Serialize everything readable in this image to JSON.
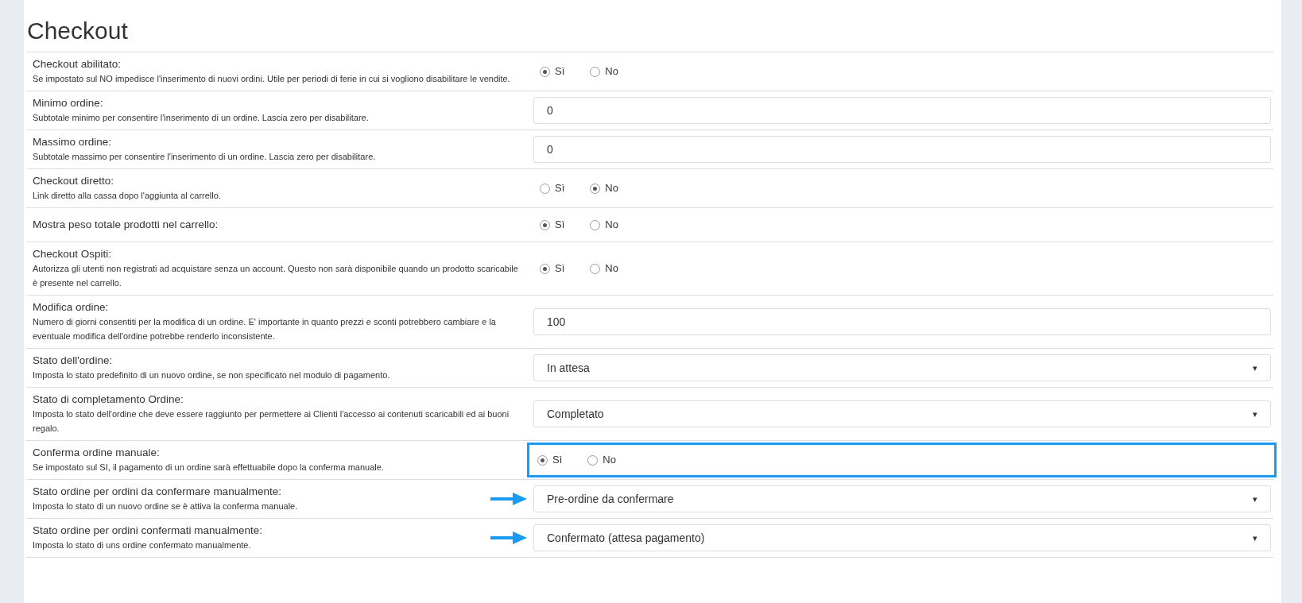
{
  "title": "Checkout",
  "rows": [
    {
      "kind": "radio",
      "label": "Checkout abilitato:",
      "description": "Se impostato sul NO impedisce l'inserimento di nuovi ordini. Utile per periodi di ferie in cui si vogliono disabilitare le vendite.",
      "options": [
        {
          "label": "Sì",
          "selected": true
        },
        {
          "label": "No",
          "selected": false
        }
      ],
      "highlighted": false,
      "arrow": false
    },
    {
      "kind": "text",
      "label": "Minimo ordine:",
      "description": "Subtotale minimo per consentire l'inserimento di un ordine. Lascia zero per disabilitare.",
      "value": "0",
      "highlighted": false,
      "arrow": false
    },
    {
      "kind": "text",
      "label": "Massimo ordine:",
      "description": "Subtotale massimo per consentire l'inserimento di un ordine. Lascia zero per disabilitare.",
      "value": "0",
      "highlighted": false,
      "arrow": false
    },
    {
      "kind": "radio",
      "label": "Checkout diretto:",
      "description": "Link diretto alla cassa dopo l'aggiunta al carrello.",
      "options": [
        {
          "label": "Sì",
          "selected": false
        },
        {
          "label": "No",
          "selected": true
        }
      ],
      "highlighted": false,
      "arrow": false
    },
    {
      "kind": "radio",
      "label": "Mostra peso totale prodotti nel carrello:",
      "options": [
        {
          "label": "Sì",
          "selected": true
        },
        {
          "label": "No",
          "selected": false
        }
      ],
      "highlighted": false,
      "arrow": false
    },
    {
      "kind": "radio",
      "label": "Checkout Ospiti:",
      "description": "Autorizza gli utenti non registrati ad acquistare senza un account. Questo non sarà disponibile quando un prodotto scaricabile è presente nel carrello.",
      "options": [
        {
          "label": "Sì",
          "selected": true
        },
        {
          "label": "No",
          "selected": false
        }
      ],
      "highlighted": false,
      "arrow": false
    },
    {
      "kind": "text",
      "label": "Modifica ordine:",
      "description": "Numero di giorni consentiti per la modifica di un ordine. E' importante in quanto prezzi e sconti potrebbero cambiare e la eventuale modifica dell'ordine potrebbe renderlo inconsistente.",
      "value": "100",
      "highlighted": false,
      "arrow": false
    },
    {
      "kind": "select",
      "label": "Stato dell'ordine:",
      "description": "Imposta lo stato predefinito di un nuovo ordine, se non specificato nel modulo di pagamento.",
      "value": "In attesa",
      "caret": "▾",
      "highlighted": false,
      "arrow": false
    },
    {
      "kind": "select",
      "label": "Stato di completamento Ordine:",
      "description": "Imposta lo stato dell'ordine che deve essere raggiunto per permettere ai Clienti l'accesso ai contenuti scaricabili ed ai buoni regalo.",
      "value": "Completato",
      "caret": "▾",
      "highlighted": false,
      "arrow": false
    },
    {
      "kind": "radio",
      "label": "Conferma ordine manuale:",
      "description": "Se impostato sul SI, il pagamento di un ordine sarà effettuabile dopo la conferma manuale.",
      "options": [
        {
          "label": "Sì",
          "selected": true
        },
        {
          "label": "No",
          "selected": false
        }
      ],
      "highlighted": true,
      "arrow": false
    },
    {
      "kind": "select",
      "label": "Stato ordine per ordini da confermare manualmente:",
      "description": "Imposta lo stato di un nuovo ordine se è attiva la conferma manuale.",
      "value": "Pre-ordine da confermare",
      "caret": "▾",
      "highlighted": false,
      "arrow": true
    },
    {
      "kind": "select",
      "label": "Stato ordine per ordini confermati manualmente:",
      "description": "Imposta lo stato di uns ordine confermato manualmente.",
      "value": "Confermato (attesa pagamento)",
      "caret": "▾",
      "highlighted": false,
      "arrow": true
    }
  ]
}
